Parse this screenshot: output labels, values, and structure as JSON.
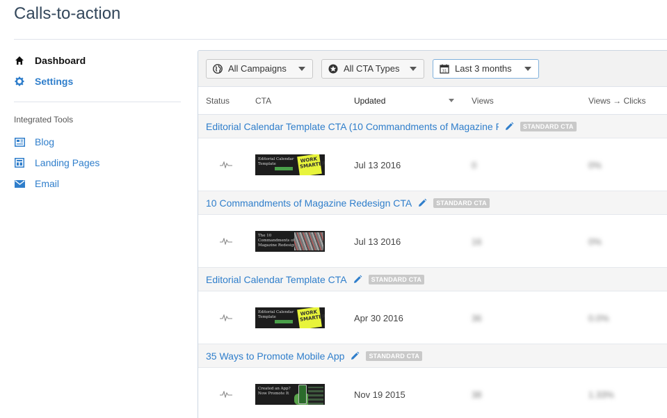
{
  "page": {
    "title": "Calls-to-action"
  },
  "sidebar": {
    "items": [
      {
        "label": "Dashboard",
        "icon": "home-icon"
      },
      {
        "label": "Settings",
        "icon": "gear-icon"
      }
    ],
    "tools_heading": "Integrated Tools",
    "tools": [
      {
        "label": "Blog",
        "icon": "blog-icon"
      },
      {
        "label": "Landing Pages",
        "icon": "landing-pages-icon"
      },
      {
        "label": "Email",
        "icon": "envelope-icon"
      }
    ]
  },
  "filters": {
    "campaigns": "All Campaigns",
    "cta_types": "All CTA Types",
    "date_range": "Last 3 months"
  },
  "table": {
    "columns": {
      "status": "Status",
      "cta": "CTA",
      "updated": "Updated",
      "views": "Views",
      "views_clicks": "Views → Clicks"
    },
    "rows": [
      {
        "name": "Editorial Calendar Template CTA (10 Commandments of Magazine R",
        "badge": "STANDARD CTA",
        "thumb_text": "Editorial Calendar Template",
        "thumb_note": "WORK SMARTER",
        "updated": "Jul 13 2016",
        "views": "0",
        "rate": "0%"
      },
      {
        "name": "10 Commandments of Magazine Redesign CTA",
        "badge": "STANDARD CTA",
        "thumb_text": "The 10 Commandments of Magazine Redesign",
        "thumb_note": "",
        "updated": "Jul 13 2016",
        "views": "16",
        "rate": "0%"
      },
      {
        "name": "Editorial Calendar Template CTA",
        "badge": "STANDARD CTA",
        "thumb_text": "Editorial Calendar Template",
        "thumb_note": "WORK SMARTER",
        "updated": "Apr 30 2016",
        "views": "36",
        "rate": "0.0%"
      },
      {
        "name": "35 Ways to Promote Mobile App",
        "badge": "STANDARD CTA",
        "thumb_text": "Created an App? Now Promote It",
        "thumb_note": "",
        "updated": "Nov 19 2015",
        "views": "38",
        "rate": "1.33%"
      }
    ]
  },
  "colors": {
    "link": "#2f7ecb",
    "text": "#33475b",
    "badge": "#c9c9c9",
    "note": "#e8f43b"
  }
}
